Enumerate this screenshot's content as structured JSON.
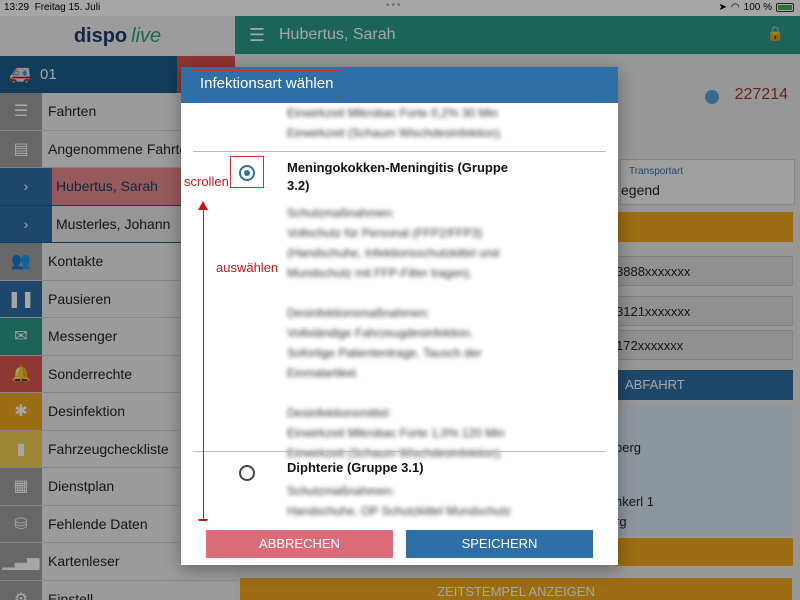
{
  "status_bar": {
    "time": "13:29",
    "date": "Freitag 15. Juli",
    "battery": "100 %"
  },
  "app": {
    "logo_a": "dispo",
    "logo_b": "live"
  },
  "sidebar": {
    "vehicle_number": "01",
    "items": [
      {
        "label": "Fahrten",
        "icon": "list-icon",
        "color": "#9e9e9e"
      },
      {
        "label": "Angenommene Fahrten",
        "icon": "id-card-icon",
        "color": "#9e9e9e"
      }
    ],
    "sub_items": [
      {
        "label": "Hubertus, Sarah"
      },
      {
        "label": "Musterles, Johann"
      }
    ],
    "items2": [
      {
        "label": "Kontakte",
        "icon": "contacts-icon",
        "color": "#9e9e9e"
      },
      {
        "label": "Pausieren",
        "icon": "pause-icon",
        "color": "#2d6fa6"
      },
      {
        "label": "Messenger",
        "icon": "mail-icon",
        "color": "#2d9a88"
      },
      {
        "label": "Sonderrechte",
        "icon": "bell-icon",
        "color": "#d9534f"
      },
      {
        "label": "Desinfektion",
        "icon": "bug-icon",
        "color": "#f0a81c"
      },
      {
        "label": "Fahrzeugchecklistе",
        "icon": "book-icon",
        "color": "#f0d050"
      },
      {
        "label": "Dienstplan",
        "icon": "calendar-icon",
        "color": "#9e9e9e"
      },
      {
        "label": "Fehlende Daten",
        "icon": "database-icon",
        "color": "#9e9e9e"
      },
      {
        "label": "Kartenleser",
        "icon": "signal-icon",
        "color": "#9e9e9e"
      },
      {
        "label": "Einstell...",
        "icon": "settings-icon",
        "color": "#9e9e9e"
      }
    ]
  },
  "header": {
    "title": "Hubertus, Sarah"
  },
  "main": {
    "id_number": "227214",
    "transport_label": "Transportart",
    "transport_value": "egend",
    "phones": [
      "3888xxxxxxx",
      "3121xxxxxxx",
      "172xxxxxxx"
    ],
    "abfahrt": "ABFAHRT",
    "address_lines": [
      "berg",
      "nkerl 1",
      "rg"
    ],
    "zeitstempel": "ZEITSTEMPEL ANZEIGEN"
  },
  "dialog": {
    "title": "Infektionsart wählen",
    "prev_option_lines": [
      "Einwirkzeit Mikrobac Forte 0,2% 30 Min",
      "Einwirkzeit (Schaum Wischdesinfektion)."
    ],
    "option1": {
      "title_line1": "Meningokokken-Meningitis (Gruppe",
      "title_line2": "3.2)",
      "selected": true,
      "blurred_lines": [
        "Schutzmaßnahmen:",
        "Vollschutz für Personal (FFP2/FFP3)",
        "(Handschuhe, Infektionsschutzkittel und",
        "Mundschutz mit FFP-Filter tragen).",
        "",
        "Desinfektionsmaßnahmen:",
        "Vollständige Fahrzeugdesinfektion.",
        "Sofortige Patiententrage, Tausch der",
        "Einmalartikel.",
        "",
        "Desinfektionsmittel:",
        "Einwirkzeit Mikrobac Forte 1,0% 120 Min",
        "Einwirkzeit (Schaum Wischdesinfektion)."
      ]
    },
    "option2": {
      "title": "Diphterie (Gruppe 3.1)",
      "selected": false,
      "blurred_lines": [
        "Schutzmaßnahmen:",
        "Handschuhe, OP Schutzkittel Mundschutz"
      ]
    },
    "annotations": {
      "scroll": "scrollen",
      "select": "auswählen"
    },
    "cancel_label": "ABBRECHEN",
    "save_label": "SPEICHERN"
  }
}
